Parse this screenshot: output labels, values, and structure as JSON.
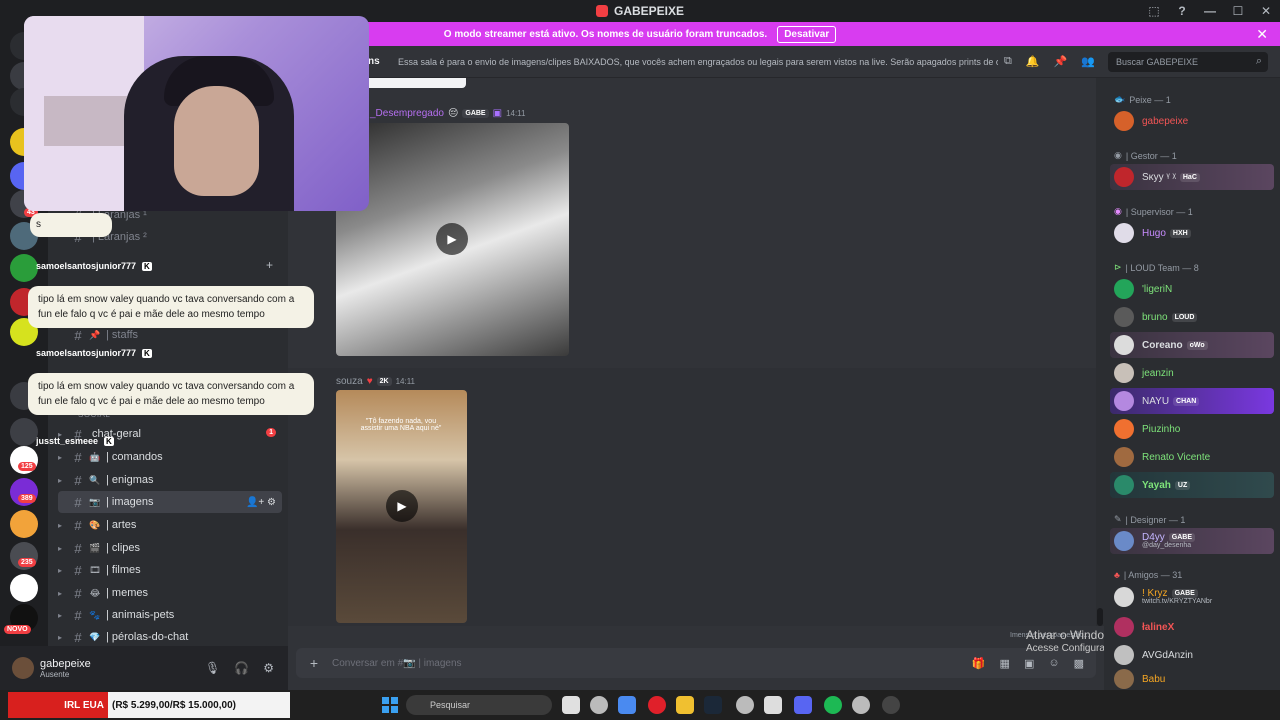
{
  "window": {
    "title": "GABEPEIXE",
    "controls": [
      "⬚",
      "?",
      "—",
      "☐",
      "✕"
    ]
  },
  "banner": {
    "text": "O modo streamer está ativo. Os nomes de usuário foram truncados.",
    "button": "Desativar",
    "color": "#d83cf0"
  },
  "header": {
    "channel": "ns",
    "topic": "Essa sala é para o envio de imagens/clipes BAIXADOS, que vocês achem engraçados ou legais para serem vistos na live. Serão apagados prints de o...",
    "search_placeholder": "Buscar GABEPEIXE"
  },
  "channels": {
    "items": [
      {
        "name": "| Laranjas ¹",
        "emoji": ""
      },
      {
        "name": "| Laranjas ²",
        "emoji": ""
      },
      {
        "name": "| staffs",
        "emoji": "📌"
      },
      {
        "name": "chat-geral",
        "emoji": ""
      },
      {
        "name": "| comandos",
        "emoji": "🤖"
      },
      {
        "name": "| enigmas",
        "emoji": "🔍"
      },
      {
        "name": "| imagens",
        "emoji": "📷"
      },
      {
        "name": "| artes",
        "emoji": "🎨"
      },
      {
        "name": "| clipes",
        "emoji": "🎬"
      },
      {
        "name": "| filmes",
        "emoji": "🎞"
      },
      {
        "name": "| memes",
        "emoji": "😂"
      },
      {
        "name": "| animais-pets",
        "emoji": "🐾"
      },
      {
        "name": "| pérolas-do-chat",
        "emoji": "💎"
      }
    ],
    "category": "SOCIAL",
    "unread_badge": "1"
  },
  "server_badges": [
    "43",
    "125",
    "389",
    "235",
    "NOVO"
  ],
  "user": {
    "name": "gabepeixe",
    "status": "Ausente"
  },
  "overlay_chat": [
    {
      "user": "samoelsantosjunior777",
      "text": "tipo lá em snow valey quando vc tava conversando com a fun ele falo q vc é pai e mãe dele ao mesmo tempo"
    },
    {
      "user": "samoelsantosjunior777",
      "text": "tipo lá em snow valey quando vc tava conversando com a fun ele falo q vc é pai e mãe dele ao mesmo tempo"
    },
    {
      "user": "jusstt_esmeee",
      "text": ""
    }
  ],
  "overlay_partial": "s",
  "messages": [
    {
      "author": "_Desempregado",
      "tag": "GABE",
      "time": "14:11"
    },
    {
      "author": "souza",
      "tag": "2K",
      "time": "14:11",
      "caption": "\"Tô fazendo nada, vou assistir uma NBA aqui né\""
    }
  ],
  "composer": {
    "placeholder": "Conversar em #📷 | imagens"
  },
  "watermark": {
    "line1": "Ativar o Windows",
    "line2": "Acesse Configurações para ativar o Windows.",
    "typing": "Imensas pessoas estão..."
  },
  "members": {
    "roles": [
      {
        "label": "Peixe — 1"
      },
      {
        "label": "| Gestor — 1"
      },
      {
        "label": "| Supervisor — 1"
      },
      {
        "label": "| LOUD Team — 8"
      },
      {
        "label": "| Designer — 1"
      },
      {
        "label": "| Amigos — 31"
      }
    ],
    "list": [
      {
        "name": "gabepeixe",
        "tag": "",
        "color": "#f25555"
      },
      {
        "name": "Sκуу ᵞ ᵡ",
        "tag": "HaC",
        "color": "#ffffff"
      },
      {
        "name": "Hugo",
        "tag": "HXH",
        "color": "#c88cff"
      },
      {
        "name": "'ligeriN",
        "tag": "",
        "color": "#7ee37a"
      },
      {
        "name": "bruno",
        "tag": "LOUD",
        "color": "#7ee37a"
      },
      {
        "name": "Coreano",
        "tag": "oWo",
        "color": "#ffffff"
      },
      {
        "name": "jeanzin",
        "tag": "",
        "color": "#7ee37a"
      },
      {
        "name": "NAYU",
        "tag": "CHAN",
        "color": "#ffffff"
      },
      {
        "name": "Piuzinho",
        "tag": "",
        "color": "#7ee37a"
      },
      {
        "name": "Renato Vicente",
        "tag": "",
        "color": "#7ee37a"
      },
      {
        "name": "Yayah",
        "tag": "UZ",
        "color": "#7ee37a"
      },
      {
        "name": "D4yy",
        "tag": "GABE",
        "sub": "@day_desenha",
        "color": "#c4b5ff"
      },
      {
        "name": "! Kryz",
        "tag": "GABE",
        "sub": "twitch.tv/KRYZTYANbr",
        "color": "#f5a623"
      },
      {
        "name": "łalineX",
        "tag": "",
        "color": "#f25555"
      },
      {
        "name": "AVGdAnzin",
        "tag": "",
        "color": "#dbdee1"
      },
      {
        "name": "Babu",
        "tag": "",
        "color": "#f5a623"
      }
    ]
  },
  "taskbar": {
    "ticker_label": "IRL EUA",
    "ticker_value": "(R$ 5.299,00/R$ 15.000,00)",
    "search_placeholder": "Pesquisar"
  }
}
